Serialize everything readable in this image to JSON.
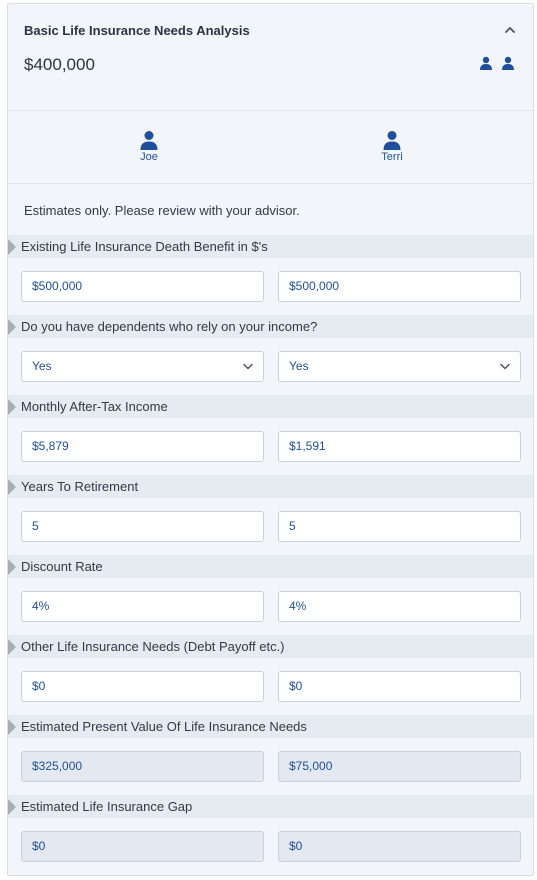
{
  "header": {
    "title": "Basic Life Insurance Needs Analysis",
    "amount": "$400,000",
    "collapse_icon": "chevron-up-icon",
    "people_icon": "person-icon"
  },
  "people": [
    {
      "name": "Joe",
      "icon": "person-icon"
    },
    {
      "name": "Terri",
      "icon": "person-icon"
    }
  ],
  "note": "Estimates only. Please review with your advisor.",
  "sections": [
    {
      "label": "Existing Life Insurance Death Benefit in $'s",
      "values": [
        "$500,000",
        "$500,000"
      ],
      "type": "input"
    },
    {
      "label": "Do you have dependents who rely on your income?",
      "values": [
        "Yes",
        "Yes"
      ],
      "type": "select"
    },
    {
      "label": "Monthly After-Tax Income",
      "values": [
        "$5,879",
        "$1,591"
      ],
      "type": "input"
    },
    {
      "label": "Years To Retirement",
      "values": [
        "5",
        "5"
      ],
      "type": "input"
    },
    {
      "label": "Discount Rate",
      "values": [
        "4%",
        "4%"
      ],
      "type": "input"
    },
    {
      "label": "Other Life Insurance Needs (Debt Payoff etc.)",
      "values": [
        "$0",
        "$0"
      ],
      "type": "input"
    },
    {
      "label": "Estimated Present Value Of Life Insurance Needs",
      "values": [
        "$325,000",
        "$75,000"
      ],
      "type": "readonly"
    },
    {
      "label": "Estimated Life Insurance Gap",
      "values": [
        "$0",
        "$0"
      ],
      "type": "readonly"
    }
  ],
  "colors": {
    "accent": "#1f4f9a",
    "panel_bg": "#f2f5fa",
    "section_bg": "#e6eaf1",
    "readonly_bg": "#e4e9f1"
  }
}
